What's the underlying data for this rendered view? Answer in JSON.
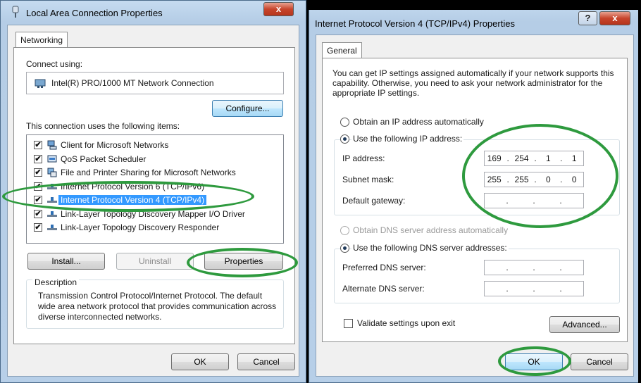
{
  "dialog1": {
    "title": "Local Area Connection Properties",
    "tab": "Networking",
    "connect_using_label": "Connect using:",
    "adapter_name": "Intel(R) PRO/1000 MT Network Connection",
    "configure_label": "Configure...",
    "items_label": "This connection uses the following items:",
    "items": [
      {
        "label": "Client for Microsoft Networks",
        "checked": true,
        "icon": "network-client-icon"
      },
      {
        "label": "QoS Packet Scheduler",
        "checked": true,
        "icon": "qos-scheduler-icon"
      },
      {
        "label": "File and Printer Sharing for Microsoft Networks",
        "checked": true,
        "icon": "file-printer-sharing-icon"
      },
      {
        "label": "Internet Protocol Version 6 (TCP/IPv6)",
        "checked": true,
        "icon": "protocol-icon"
      },
      {
        "label": "Internet Protocol Version 4 (TCP/IPv4)",
        "checked": true,
        "icon": "protocol-icon",
        "selected": true
      },
      {
        "label": "Link-Layer Topology Discovery Mapper I/O Driver",
        "checked": true,
        "icon": "protocol-icon"
      },
      {
        "label": "Link-Layer Topology Discovery Responder",
        "checked": true,
        "icon": "protocol-icon"
      }
    ],
    "install_label": "Install...",
    "uninstall_label": "Uninstall",
    "properties_label": "Properties",
    "description_title": "Description",
    "description_text": "Transmission Control Protocol/Internet Protocol. The default wide area network protocol that provides communication across diverse interconnected networks.",
    "ok_label": "OK",
    "cancel_label": "Cancel",
    "close_glyph": "x"
  },
  "dialog2": {
    "title": "Internet Protocol Version 4 (TCP/IPv4) Properties",
    "tab": "General",
    "intro_text": "You can get IP settings assigned automatically if your network supports this capability. Otherwise, you need to ask your network administrator for the appropriate IP settings.",
    "obtain_ip_auto_label": "Obtain an IP address automatically",
    "use_following_ip_label": "Use the following IP address:",
    "ip_address_label": "IP address:",
    "ip_address": [
      "169",
      "254",
      "1",
      "1"
    ],
    "subnet_mask_label": "Subnet mask:",
    "subnet_mask": [
      "255",
      "255",
      "0",
      "0"
    ],
    "default_gateway_label": "Default gateway:",
    "obtain_dns_auto_label": "Obtain DNS server address automatically",
    "use_following_dns_label": "Use the following DNS server addresses:",
    "preferred_dns_label": "Preferred DNS server:",
    "alternate_dns_label": "Alternate DNS server:",
    "validate_label": "Validate settings upon exit",
    "advanced_label": "Advanced...",
    "ok_label": "OK",
    "cancel_label": "Cancel",
    "help_glyph": "?",
    "close_glyph": "x",
    "dot": "."
  },
  "colors": {
    "highlight": "#3399ff",
    "annotation_green": "#2e9a3e",
    "close_red": "#c7452c"
  }
}
